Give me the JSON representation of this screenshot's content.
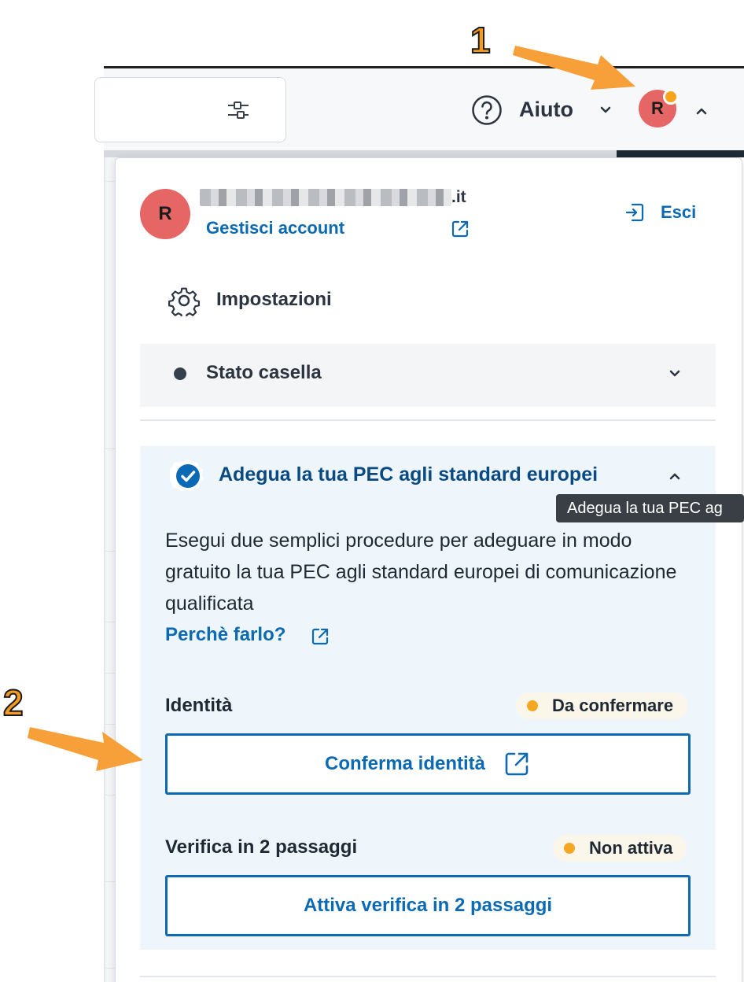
{
  "header": {
    "help_label": "Aiuto",
    "avatar_initial": "R"
  },
  "account": {
    "avatar_initial": "R",
    "email_suffix": ".it",
    "manage_label": "Gestisci account",
    "logout_label": "Esci"
  },
  "menu": {
    "settings_label": "Impostazioni",
    "status_label": "Stato casella"
  },
  "pec": {
    "title": "Adegua la tua PEC agli standard europei",
    "tooltip": "Adegua la tua PEC ag",
    "description": "Esegui due semplici procedure per adeguare in modo gratuito la tua PEC agli standard europei di comunicazione qualificata",
    "why_label": "Perchè farlo?",
    "identity": {
      "label": "Identità",
      "status": "Da confermare",
      "button": "Conferma identità"
    },
    "two_step": {
      "label": "Verifica in 2 passaggi",
      "status": "Non attiva",
      "button": "Attiva verifica in 2 passaggi"
    }
  },
  "annotations": {
    "step_1": "1",
    "step_2": "2"
  },
  "colors": {
    "link_blue": "#0b6ab3",
    "title_blue": "#0a4a82",
    "avatar_red": "#e66666",
    "status_orange": "#f5a623",
    "annotation_orange": "#f29a24"
  },
  "icons": {
    "filter": "sliders-icon",
    "help": "question-circle-icon",
    "logout": "sign-out-icon",
    "external": "external-link-icon",
    "settings": "gear-icon",
    "verified": "check-badge-icon"
  }
}
